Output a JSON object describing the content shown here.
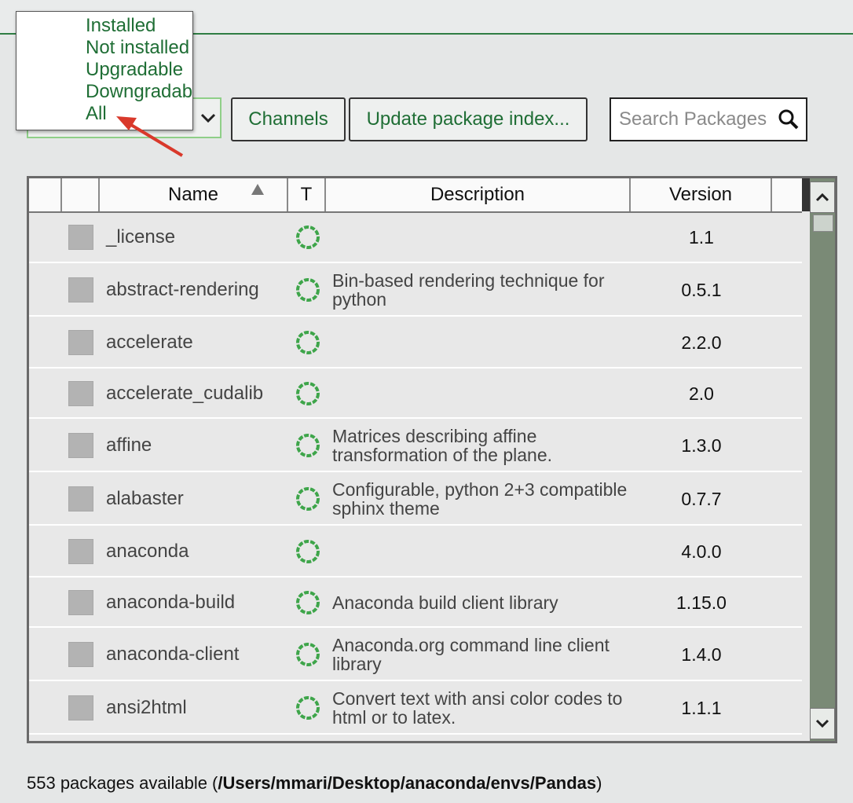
{
  "toolbar": {
    "channels_label": "Channels",
    "update_index_label": "Update package index...",
    "search_placeholder": "Search Packages"
  },
  "filter_dropdown": {
    "selected": "Installed",
    "options": [
      "Installed",
      "Not installed",
      "Upgradable",
      "Downgradable",
      "All"
    ],
    "options_visible_text": [
      "Installed",
      "Not installed",
      "Upgradable",
      "Downgradab",
      "All"
    ]
  },
  "table": {
    "headers": {
      "name": "Name",
      "type": "T",
      "description": "Description",
      "version": "Version"
    },
    "rows": [
      {
        "name": "_license",
        "description": "",
        "version": "1.1"
      },
      {
        "name": "abstract-rendering",
        "description": "Bin-based rendering technique for python",
        "version": "0.5.1"
      },
      {
        "name": "accelerate",
        "description": "",
        "version": "2.2.0"
      },
      {
        "name": "accelerate_cudalib",
        "description": "",
        "version": "2.0"
      },
      {
        "name": "affine",
        "description": "Matrices describing affine transformation of the plane.",
        "version": "1.3.0"
      },
      {
        "name": "alabaster",
        "description": "Configurable, python 2+3 compatible sphinx theme",
        "version": "0.7.7"
      },
      {
        "name": "anaconda",
        "description": "",
        "version": "4.0.0"
      },
      {
        "name": "anaconda-build",
        "description": "Anaconda build client library",
        "version": "1.15.0"
      },
      {
        "name": "anaconda-client",
        "description": "Anaconda.org command line client library",
        "version": "1.4.0"
      },
      {
        "name": "ansi2html",
        "description": "Convert text with ansi color codes to html or to latex.",
        "version": "1.1.1"
      }
    ]
  },
  "status": {
    "count_text": "553 packages available (",
    "path": "/Users/mmari/Desktop/anaconda/envs/Pandas",
    "close": ")"
  },
  "colors": {
    "accent_green": "#1f6e35",
    "rule_green": "#2f7d43",
    "annotation_arrow": "#d9392b"
  }
}
